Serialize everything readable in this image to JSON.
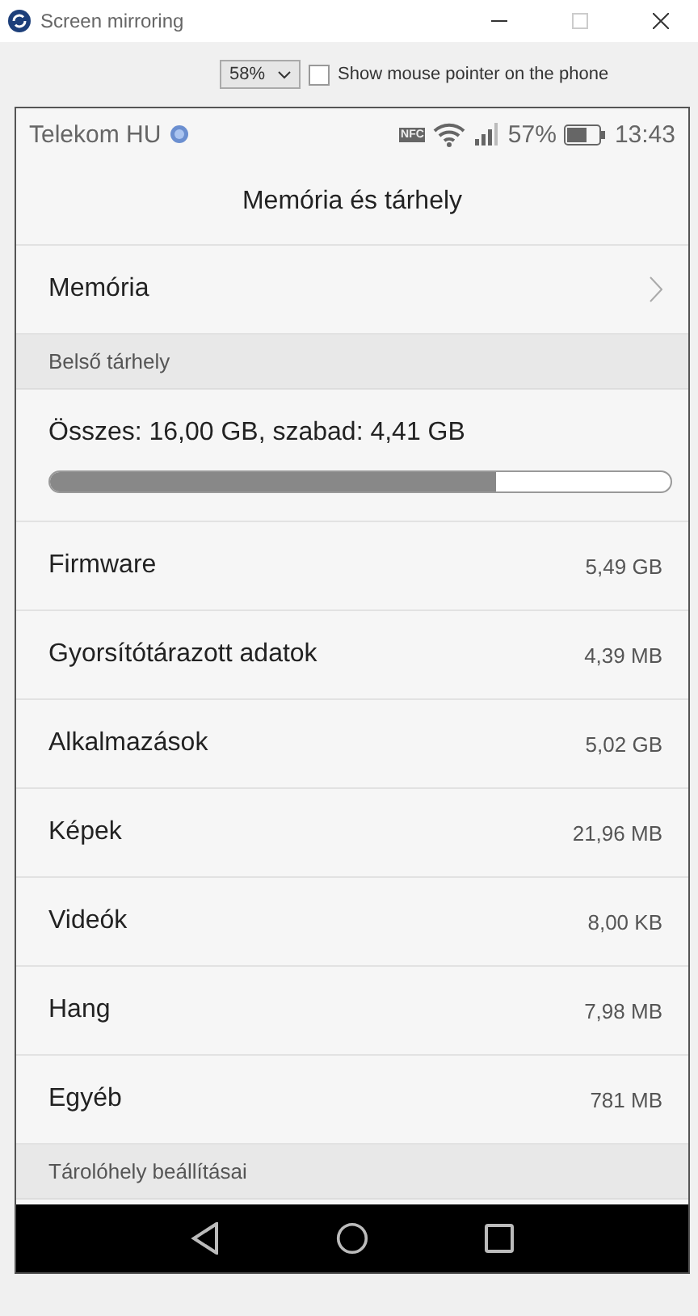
{
  "window": {
    "title": "Screen mirroring"
  },
  "toolbar": {
    "zoom": "58%",
    "show_pointer": {
      "label": "Show mouse pointer on the phone",
      "checked": false
    }
  },
  "status_bar": {
    "carrier": "Telekom HU",
    "nfc": "NFC",
    "battery_percent": "57%",
    "time": "13:43"
  },
  "screen_title": "Memória és tárhely",
  "memory_row": {
    "label": "Memória"
  },
  "internal_section": {
    "header": "Belső tárhely",
    "summary": "Összes: 16,00 GB, szabad: 4,41 GB",
    "level": 0.72
  },
  "items": [
    {
      "label": "Firmware",
      "value": "5,49 GB"
    },
    {
      "label": "Gyorsítótárazott adatok",
      "value": "4,39 MB"
    },
    {
      "label": "Alkalmazások",
      "value": "5,02 GB"
    },
    {
      "label": "Képek",
      "value": "21,96 MB"
    },
    {
      "label": "Videók",
      "value": "8,00 KB"
    },
    {
      "label": "Hang",
      "value": "7,98 MB"
    },
    {
      "label": "Egyéb",
      "value": "781 MB"
    }
  ],
  "settings_section": {
    "header": "Tárolóhely beállításai"
  }
}
